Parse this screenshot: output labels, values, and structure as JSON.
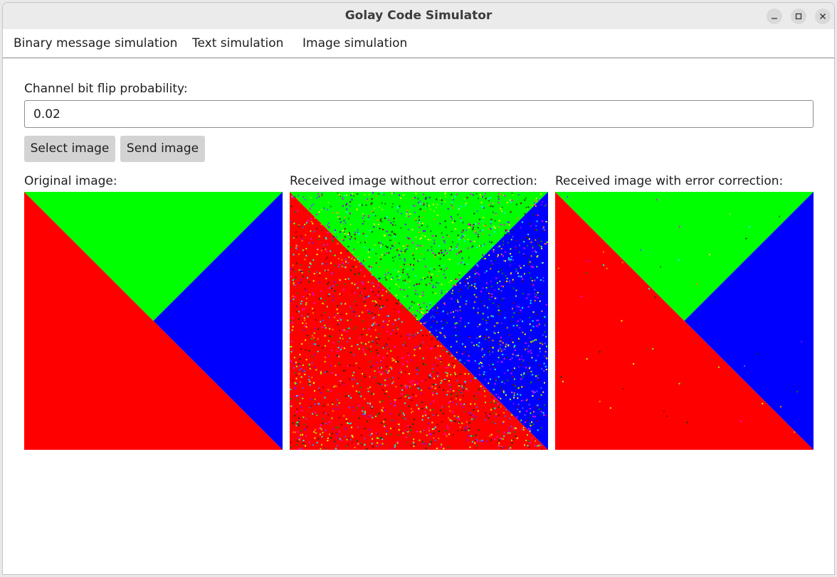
{
  "window": {
    "title": "Golay Code Simulator",
    "controls": [
      "minimize-icon",
      "maximize-icon",
      "close-icon"
    ]
  },
  "menu": {
    "items": [
      "Binary message simulation",
      "Text simulation",
      "Image simulation"
    ]
  },
  "form": {
    "probability_label": "Channel bit flip probability:",
    "probability_value": "0.02",
    "select_button": "Select image",
    "send_button": "Send image"
  },
  "images": {
    "original_label": "Original image:",
    "no_correction_label": "Received image without error correction:",
    "corrected_label": "Received image with error correction:"
  },
  "colors": {
    "red": "#ff0000",
    "green": "#00ff00",
    "blue": "#0000ff"
  }
}
